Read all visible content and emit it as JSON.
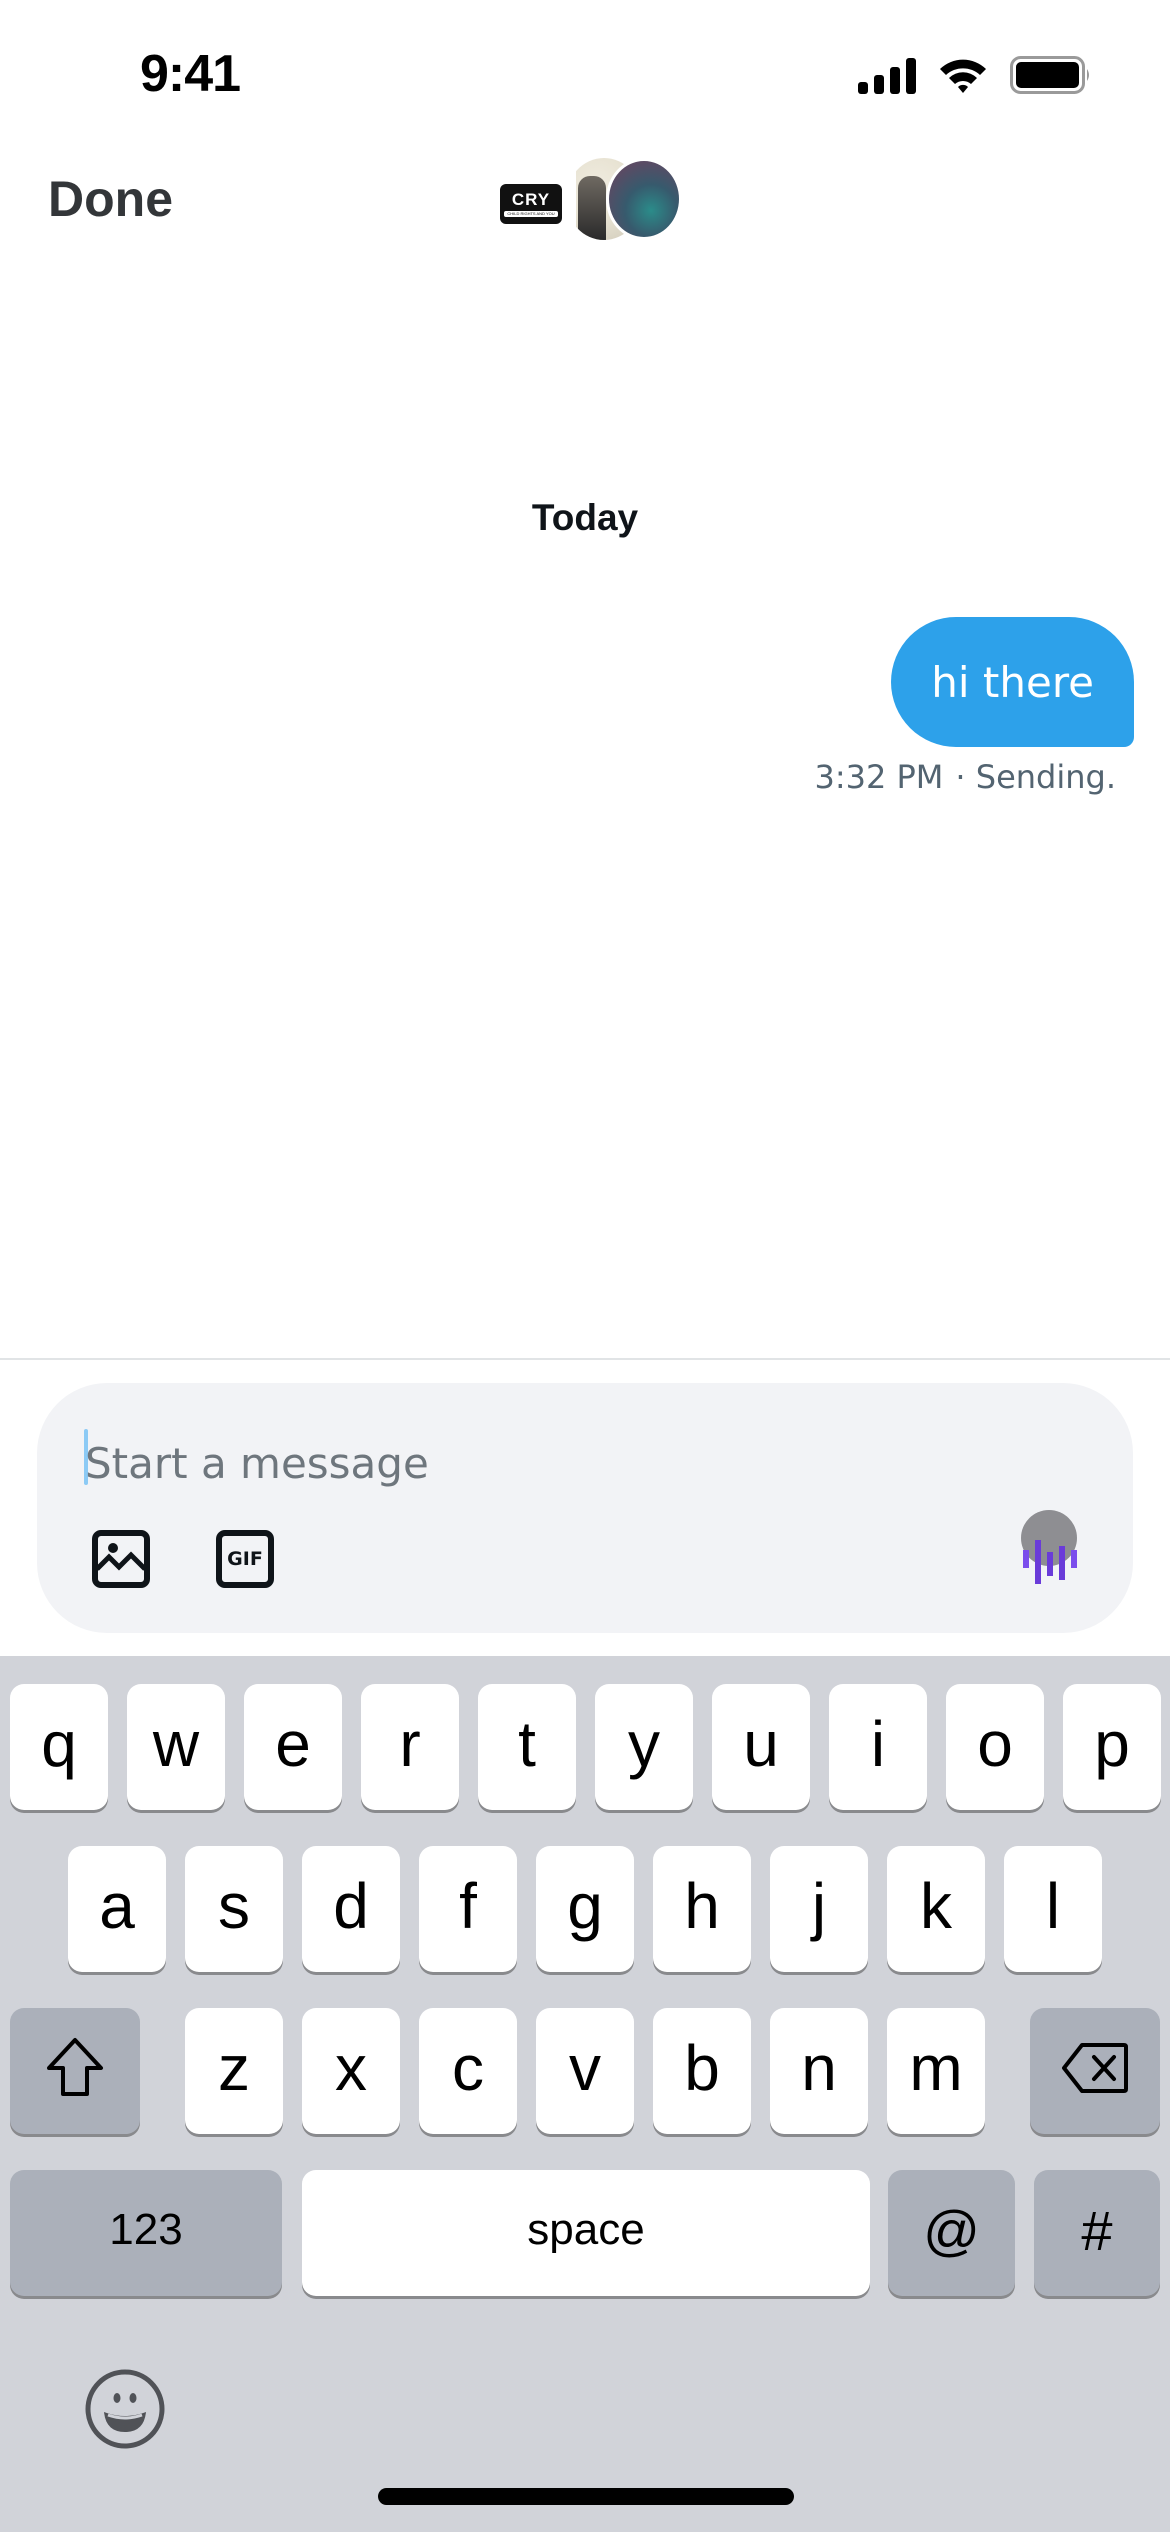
{
  "status_bar": {
    "time": "9:41",
    "icons": [
      "cellular-signal-icon",
      "wifi-icon",
      "battery-icon"
    ]
  },
  "header": {
    "done_label": "Done",
    "participants": [
      {
        "name": "cry-avatar",
        "logo_text": "CRY",
        "tagline": "CHILD RIGHTS AND YOU"
      },
      {
        "name": "person-avatar"
      },
      {
        "name": "abstract-avatar"
      }
    ]
  },
  "conversation": {
    "date_separator": "Today",
    "messages": [
      {
        "text": "hi there",
        "time": "3:32 PM",
        "status": "· Sending.",
        "sender": "me"
      }
    ]
  },
  "compose": {
    "placeholder": "Start a message",
    "value": "",
    "tools": [
      "image-icon",
      "gif-icon"
    ],
    "gif_label": "GIF",
    "voice_icon": "voice-message-icon"
  },
  "keyboard": {
    "rows": [
      [
        "q",
        "w",
        "e",
        "r",
        "t",
        "y",
        "u",
        "i",
        "o",
        "p"
      ],
      [
        "a",
        "s",
        "d",
        "f",
        "g",
        "h",
        "j",
        "k",
        "l"
      ],
      [
        "z",
        "x",
        "c",
        "v",
        "b",
        "n",
        "m"
      ]
    ],
    "shift_icon": "shift-icon",
    "delete_icon": "delete-icon",
    "numbers_label": "123",
    "space_label": "space",
    "at_label": "@",
    "hash_label": "#",
    "emoji_icon": "emoji-icon"
  },
  "colors": {
    "bubble": "#2da1ea",
    "compose_bg": "#f2f3f6",
    "keyboard_bg": "#d1d3d9",
    "voice_accent": "#7b4dec"
  }
}
